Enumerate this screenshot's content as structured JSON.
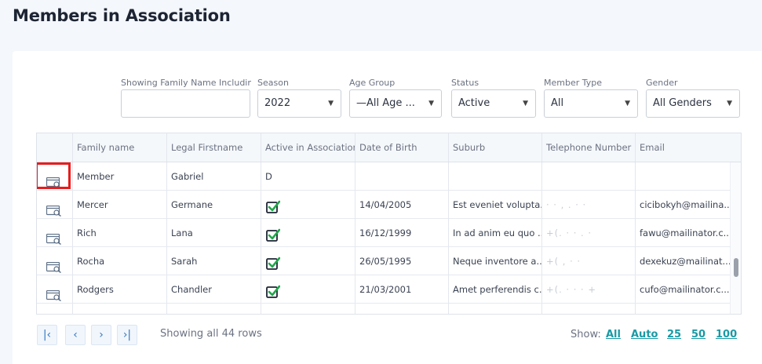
{
  "page": {
    "title": "Members in Association"
  },
  "filters": [
    {
      "label": "Showing Family Name Including",
      "value": "",
      "dropdown": false
    },
    {
      "label": "Season",
      "value": "2022",
      "dropdown": true
    },
    {
      "label": "Age Group",
      "value": "—All Age ...",
      "dropdown": true
    },
    {
      "label": "Status",
      "value": "Active",
      "dropdown": true
    },
    {
      "label": "Member Type",
      "value": "All",
      "dropdown": true
    },
    {
      "label": "Gender",
      "value": "All Genders",
      "dropdown": true
    }
  ],
  "table": {
    "columns": [
      "",
      "Family name",
      "Legal Firstname",
      "Active in Association",
      "Date of Birth",
      "Suburb",
      "Telephone Number ...",
      "Email"
    ],
    "rows": [
      {
        "family": "Member",
        "first": "Gabriel",
        "active_text": "D",
        "active_check": false,
        "dob": "",
        "suburb": "",
        "phone": "",
        "email": ""
      },
      {
        "family": "Mercer",
        "first": "Germane",
        "active_text": "",
        "active_check": true,
        "dob": "14/04/2005",
        "suburb": "Est eveniet volupta...",
        "phone": "· · , . · ·",
        "email": "cicibokyh@mailina..."
      },
      {
        "family": "Rich",
        "first": "Lana",
        "active_text": "",
        "active_check": true,
        "dob": "16/12/1999",
        "suburb": "In ad anim eu quo ...",
        "phone": "+(. · · . ·",
        "email": "fawu@mailinator.c..."
      },
      {
        "family": "Rocha",
        "first": "Sarah",
        "active_text": "",
        "active_check": true,
        "dob": "26/05/1995",
        "suburb": "Neque inventore a...",
        "phone": "+( , · ·",
        "email": "dexekuz@mailinat..."
      },
      {
        "family": "Rodgers",
        "first": "Chandler",
        "active_text": "",
        "active_check": true,
        "dob": "21/03/2001",
        "suburb": "Amet perferendis c...",
        "phone": "+(. · · · +",
        "email": "cufo@mailinator.c..."
      }
    ]
  },
  "pagination": {
    "first_icon": "first-page-icon",
    "prev_icon": "prev-page-icon",
    "next_icon": "next-page-icon",
    "last_icon": "last-page-icon",
    "first_glyph": "|‹",
    "prev_glyph": "‹",
    "next_glyph": "›",
    "last_glyph": "›|",
    "showing_text": "Showing all 44 rows",
    "show_label": "Show:",
    "options": [
      "All",
      "Auto",
      "25",
      "50",
      "100"
    ]
  },
  "colors": {
    "accent": "#1a9aa5",
    "check": "#1fa84a",
    "highlight": "#e81c1c"
  }
}
